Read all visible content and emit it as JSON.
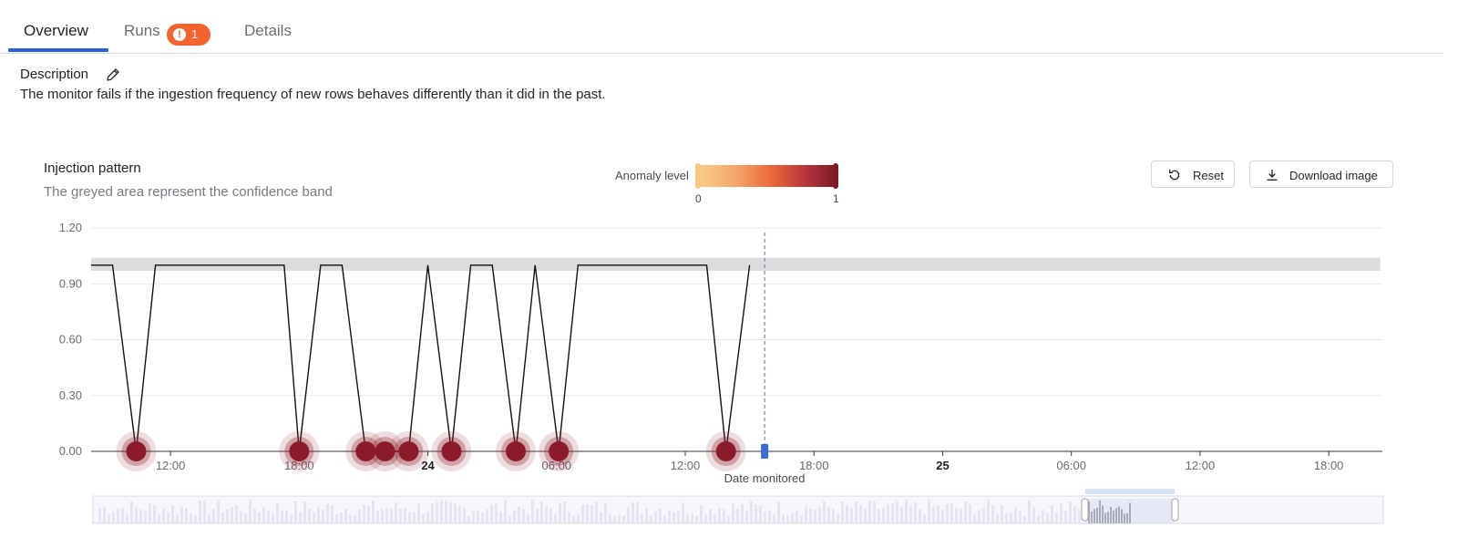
{
  "tabs": [
    {
      "label": "Overview",
      "active": true
    },
    {
      "label": "Runs",
      "badge": "1"
    },
    {
      "label": "Details"
    }
  ],
  "description": {
    "title": "Description",
    "text": "The monitor fails if the ingestion frequency of new rows behaves differently than it did in the past."
  },
  "chart_header": {
    "title": "Injection pattern",
    "subtitle": "The greyed area represent the confidence band"
  },
  "legend": {
    "label": "Anomaly level",
    "min": "0",
    "max": "1",
    "colors": [
      "#f8d08a",
      "#f3a267",
      "#ea6439",
      "#b1303b",
      "#7d1a27"
    ]
  },
  "buttons": {
    "reset": "Reset",
    "download": "Download image"
  },
  "colors": {
    "accent": "#2e5fe0",
    "badge": "#f4622f",
    "anomaly_dot": "#8b1a2b",
    "band": "#dcdcdf"
  },
  "chart_data": {
    "type": "line",
    "xlabel": "Date monitored",
    "ylabel": "",
    "ylim": [
      0,
      1.2
    ],
    "yticks": [
      "0.00",
      "0.30",
      "0.60",
      "0.90",
      "1.20"
    ],
    "xticks": [
      {
        "label": "12:00",
        "h": 12,
        "bold": false
      },
      {
        "label": "18:00",
        "h": 18,
        "bold": false
      },
      {
        "label": "24",
        "h": 24,
        "bold": true
      },
      {
        "label": "06:00",
        "h": 30,
        "bold": false
      },
      {
        "label": "12:00",
        "h": 36,
        "bold": false
      },
      {
        "label": "18:00",
        "h": 42,
        "bold": false
      },
      {
        "label": "25",
        "h": 48,
        "bold": true
      },
      {
        "label": "06:00",
        "h": 54,
        "bold": false
      },
      {
        "label": "12:00",
        "h": 60,
        "bold": false
      },
      {
        "label": "18:00",
        "h": 66,
        "bold": false
      }
    ],
    "x_range_hours": [
      8.3,
      68.5
    ],
    "confidence_band": [
      0.97,
      1.04
    ],
    "band_range_hours": [
      8.3,
      68.4
    ],
    "current_marker_hours": 39.7,
    "series": [
      {
        "points": [
          [
            8.3,
            1
          ],
          [
            9.3,
            1
          ],
          [
            10.4,
            0
          ],
          [
            11.3,
            1
          ],
          [
            15.3,
            1
          ],
          [
            16.3,
            1
          ],
          [
            17.3,
            1
          ],
          [
            18.0,
            0
          ],
          [
            19.0,
            1
          ],
          [
            20.0,
            1
          ],
          [
            21.1,
            0
          ],
          [
            22.0,
            0
          ],
          [
            23.1,
            0
          ],
          [
            24.0,
            1
          ],
          [
            25.1,
            0
          ],
          [
            26.0,
            1
          ],
          [
            27.0,
            1
          ],
          [
            28.1,
            0
          ],
          [
            29.0,
            1
          ],
          [
            30.1,
            0
          ],
          [
            31.0,
            1
          ],
          [
            37.0,
            1
          ],
          [
            37.9,
            0
          ],
          [
            39.0,
            1
          ]
        ],
        "anomalies": [
          {
            "x": 10.4,
            "level": 1
          },
          {
            "x": 18.0,
            "level": 1
          },
          {
            "x": 21.1,
            "level": 1
          },
          {
            "x": 22.0,
            "level": 1
          },
          {
            "x": 23.1,
            "level": 1
          },
          {
            "x": 25.1,
            "level": 1
          },
          {
            "x": 28.1,
            "level": 1
          },
          {
            "x": 30.1,
            "level": 1
          },
          {
            "x": 37.9,
            "level": 1
          }
        ]
      }
    ]
  }
}
